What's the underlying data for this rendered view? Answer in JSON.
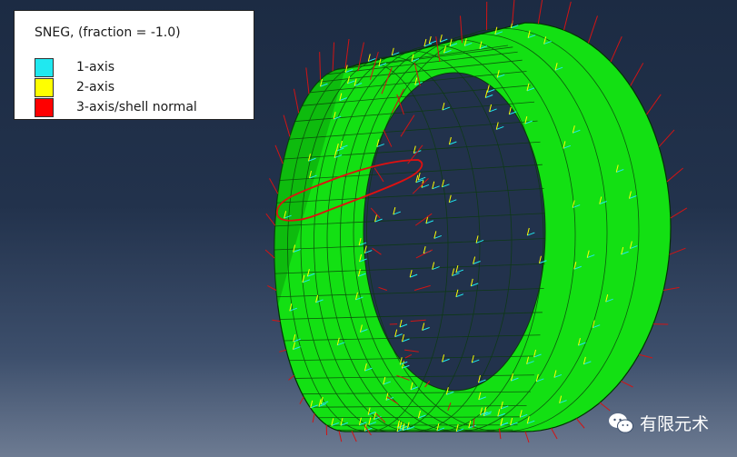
{
  "legend": {
    "title": "SNEG, (fraction = -1.0)",
    "items": [
      {
        "label": "1-axis",
        "color": "#20e8f0"
      },
      {
        "label": "2-axis",
        "color": "#ffff00"
      },
      {
        "label": "3-axis/shell normal",
        "color": "#ff0000"
      }
    ]
  },
  "model": {
    "shell_color": "#13e013",
    "inner_color": "#0b9d0b",
    "mesh_color": "#0a3a0a",
    "annotation_color": "#e01010"
  },
  "watermark": {
    "text": "有限元术",
    "icon": "wechat-icon"
  }
}
